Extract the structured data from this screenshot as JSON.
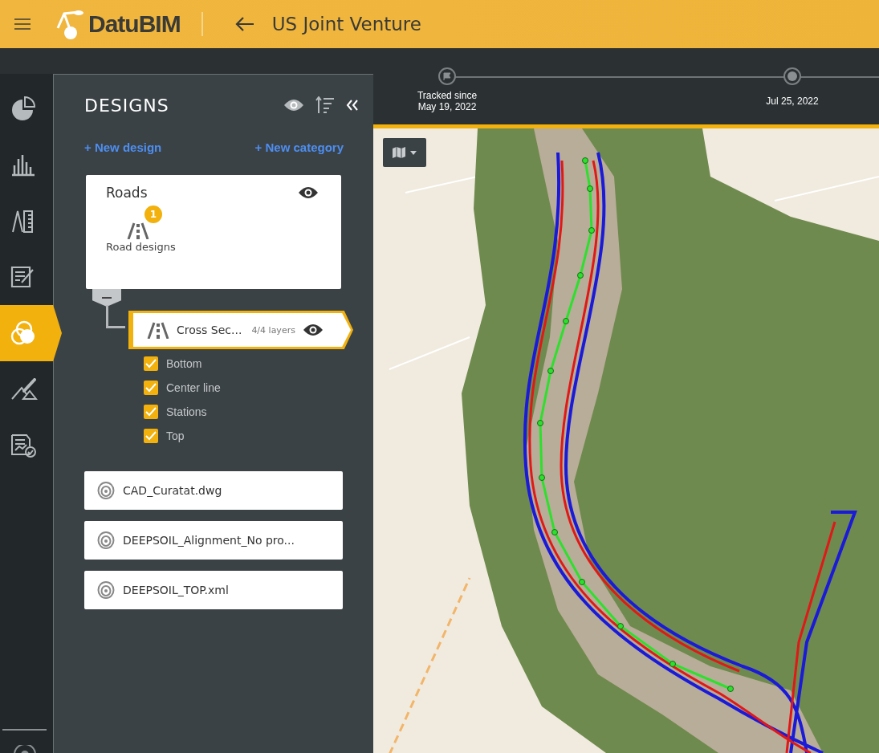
{
  "header": {
    "logo_text": "DatuBIM",
    "title": "US Joint Venture"
  },
  "rail": [
    {
      "selected": false
    },
    {
      "selected": false
    },
    {
      "selected": false
    },
    {
      "selected": false
    },
    {
      "selected": true
    },
    {
      "selected": false
    },
    {
      "selected": false
    }
  ],
  "panel": {
    "title": "DESIGNS",
    "new_design": "+ New design",
    "new_category": "+ New category",
    "category": {
      "name": "Roads",
      "visible": true,
      "badge": "1",
      "group_label": "Road designs",
      "expanded": true,
      "design": {
        "name": "Cross Sec...",
        "layers": "4/4 layers",
        "visible": true,
        "selected": true,
        "layers_list": [
          {
            "label": "Bottom",
            "checked": true
          },
          {
            "label": "Center line",
            "checked": true
          },
          {
            "label": "Stations",
            "checked": true
          },
          {
            "label": "Top",
            "checked": true
          }
        ]
      }
    },
    "files": [
      {
        "name": "CAD_Curatat.dwg"
      },
      {
        "name": "DEEPSOIL_Alignment_No pro..."
      },
      {
        "name": "DEEPSOIL_TOP.xml"
      }
    ]
  },
  "timeline": [
    {
      "kind": "start",
      "lines": [
        "Tracked since",
        "May 19, 2022"
      ]
    },
    {
      "kind": "point",
      "lines": [
        "Jul 25, 2022"
      ]
    }
  ]
}
